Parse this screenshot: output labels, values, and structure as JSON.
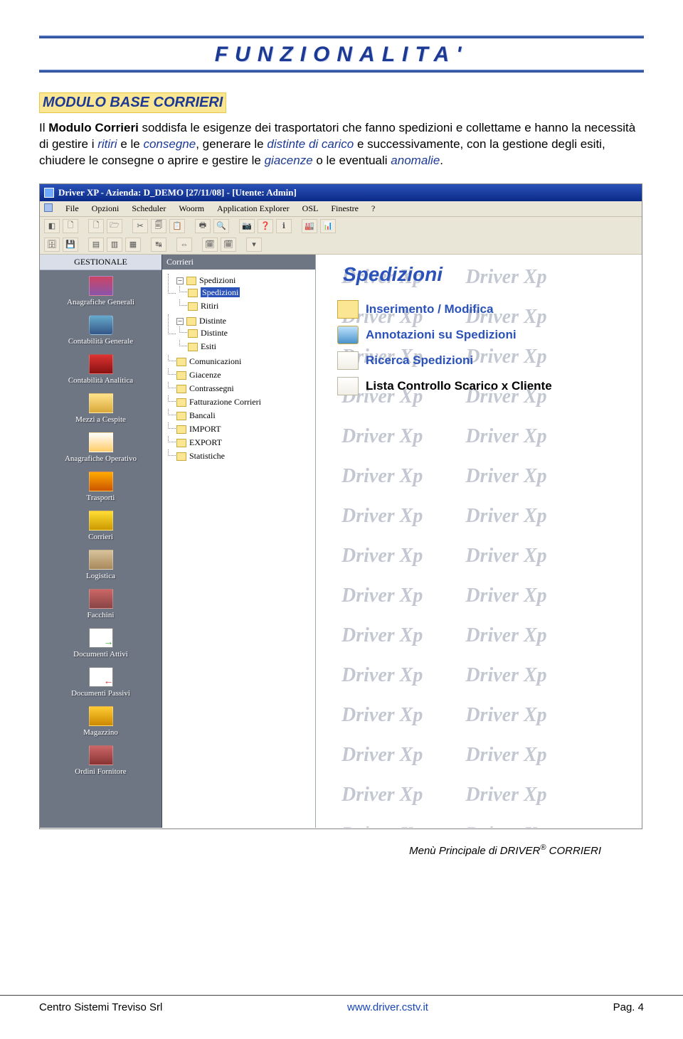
{
  "header": {
    "title": "FUNZIONALITA'"
  },
  "section": {
    "heading": "MODULO BASE CORRIERI",
    "p1_a": "Il ",
    "p1_b": "Modulo Corrieri",
    "p1_c": " soddisfa le esigenze dei trasportatori che fanno spedizioni e collettame e hanno la necessità di gestire i ",
    "p1_d": "ritiri",
    "p1_e": " e le ",
    "p1_f": "consegne",
    "p1_g": ", generare le ",
    "p1_h": "distinte di carico",
    "p1_i": " e successivamente, con la gestione degli esiti, chiudere le consegne o aprire e gestire le ",
    "p1_j": "giacenze",
    "p1_k": " o le eventuali ",
    "p1_l": "anomalie",
    "p1_m": "."
  },
  "app": {
    "titlebar": "Driver XP  -  Azienda: D_DEMO [27/11/08] - [Utente: Admin]",
    "menu": [
      "File",
      "Opzioni",
      "Scheduler",
      "Woorm",
      "Application Explorer",
      "OSL",
      "Finestre",
      "?"
    ],
    "sidebar_head": "GESTIONALE",
    "sidebar_items": [
      "Anagrafiche Generali",
      "Contabilità Generale",
      "Contabilità Analitica",
      "Mezzi a Cespite",
      "Anagrafiche Operativo",
      "Trasporti",
      "Corrieri",
      "Logistica",
      "Facchini",
      "Documenti Attivi",
      "Documenti Passivi",
      "Magazzino",
      "Ordini Fornitore"
    ],
    "tree_head": "Corrieri",
    "tree": {
      "root": "Spedizioni",
      "root_children": [
        "Spedizioni",
        "Ritiri"
      ],
      "distinte": "Distinte",
      "distinte_children": [
        "Distinte",
        "Esiti"
      ],
      "flat": [
        "Comunicazioni",
        "Giacenze",
        "Contrassegni",
        "Fatturazione Corrieri",
        "Bancali",
        "IMPORT",
        "EXPORT",
        "Statistiche"
      ]
    },
    "main_title": "Spedizioni",
    "links": [
      "Inserimento / Modifica",
      "Annotazioni su Spedizioni",
      "Ricerca Spedizioni",
      "Lista Controllo Scarico x Cliente"
    ],
    "watermark": "Driver Xp"
  },
  "caption_a": "Menù Principale di DRIVER",
  "caption_b": " CORRIERI",
  "footer": {
    "left": "Centro Sistemi Treviso Srl",
    "mid": "www.driver.cstv.it",
    "right": "Pag. 4"
  }
}
